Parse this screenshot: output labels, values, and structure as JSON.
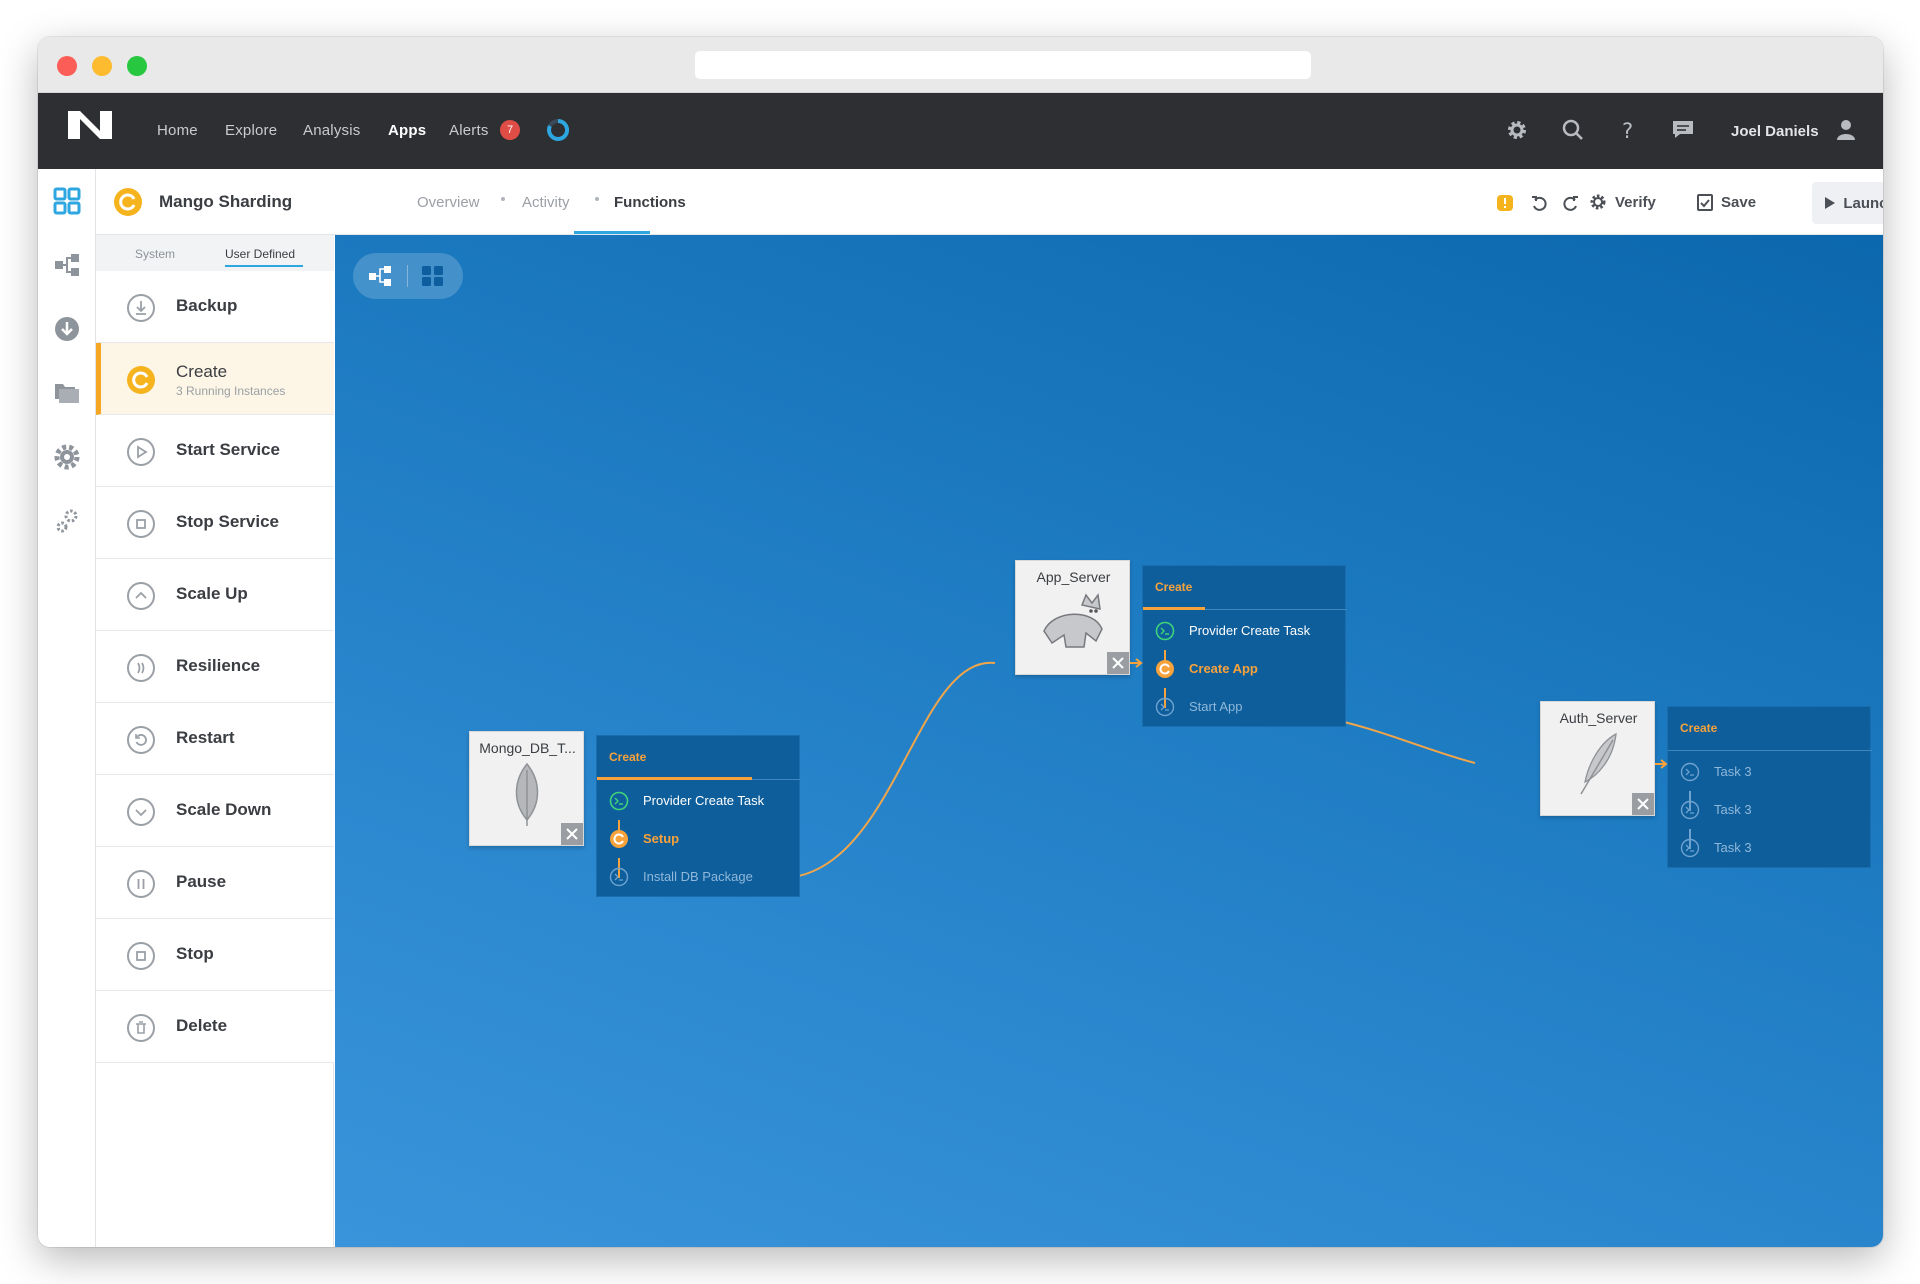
{
  "nav": {
    "items": [
      "Home",
      "Explore",
      "Analysis",
      "Apps",
      "Alerts"
    ],
    "active": "Apps",
    "alerts_count": "7",
    "user_name": "Joel Daniels"
  },
  "subheader": {
    "app_title": "Mango Sharding",
    "tabs": [
      "Overview",
      "Activity",
      "Functions"
    ],
    "active_tab": "Functions",
    "verify_label": "Verify",
    "save_label": "Save",
    "launch_label": "Launch"
  },
  "functions": {
    "tabs": [
      "System",
      "User Defined"
    ],
    "active_tab": "User Defined",
    "items": [
      {
        "label": "Backup",
        "icon": "download-icon"
      },
      {
        "label": "Create",
        "sub": "3 Running Instances",
        "icon": "create-icon",
        "active": true
      },
      {
        "label": "Start Service",
        "icon": "play-icon"
      },
      {
        "label": "Stop Service",
        "icon": "stop-icon"
      },
      {
        "label": "Scale Up",
        "icon": "chevron-up-icon"
      },
      {
        "label": "Resilience",
        "icon": "resilience-icon"
      },
      {
        "label": "Restart",
        "icon": "restart-icon"
      },
      {
        "label": "Scale Down",
        "icon": "chevron-down-icon"
      },
      {
        "label": "Pause",
        "icon": "pause-icon"
      },
      {
        "label": "Stop",
        "icon": "stop-icon"
      },
      {
        "label": "Delete",
        "icon": "trash-icon"
      }
    ]
  },
  "canvas": {
    "nodes": [
      {
        "name": "Mongo_DB_T...",
        "card_title": "Create",
        "tasks": [
          "Provider Create Task",
          "Setup",
          "Install DB Package"
        ]
      },
      {
        "name": "App_Server",
        "card_title": "Create",
        "tasks": [
          "Provider Create Task",
          "Create App",
          "Start App"
        ]
      },
      {
        "name": "Auth_Server",
        "card_title": "Create",
        "tasks": [
          "Task 3",
          "Task 3",
          "Task 3"
        ]
      }
    ]
  },
  "colors": {
    "accent": "#2ea6df",
    "orange": "#f7a23a",
    "canvas": "#1f7dc4",
    "alert": "#e04d47",
    "success": "#3fd37a"
  }
}
